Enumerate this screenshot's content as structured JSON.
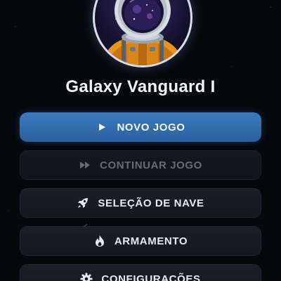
{
  "game": {
    "title": "Galaxy Vanguard I"
  },
  "menu": {
    "items": [
      {
        "label": "NOVO JOGO",
        "icon": "play-icon",
        "state": "primary"
      },
      {
        "label": "CONTINUAR JOGO",
        "icon": "fast-forward-icon",
        "state": "disabled"
      },
      {
        "label": "SELEÇÃO DE NAVE",
        "icon": "rocket-icon",
        "state": "normal"
      },
      {
        "label": "ARMAMENTO",
        "icon": "flame-icon",
        "state": "normal"
      },
      {
        "label": "CONFIGURAÇÕES",
        "icon": "gear-icon",
        "state": "normal"
      }
    ]
  },
  "colors": {
    "background": "#06080c",
    "primary_button": "#3b7bbf",
    "dark_button": "#1b1f28",
    "text": "#f3f4f7",
    "disabled_text": "#666c77",
    "suit_orange": "#e8951f"
  }
}
